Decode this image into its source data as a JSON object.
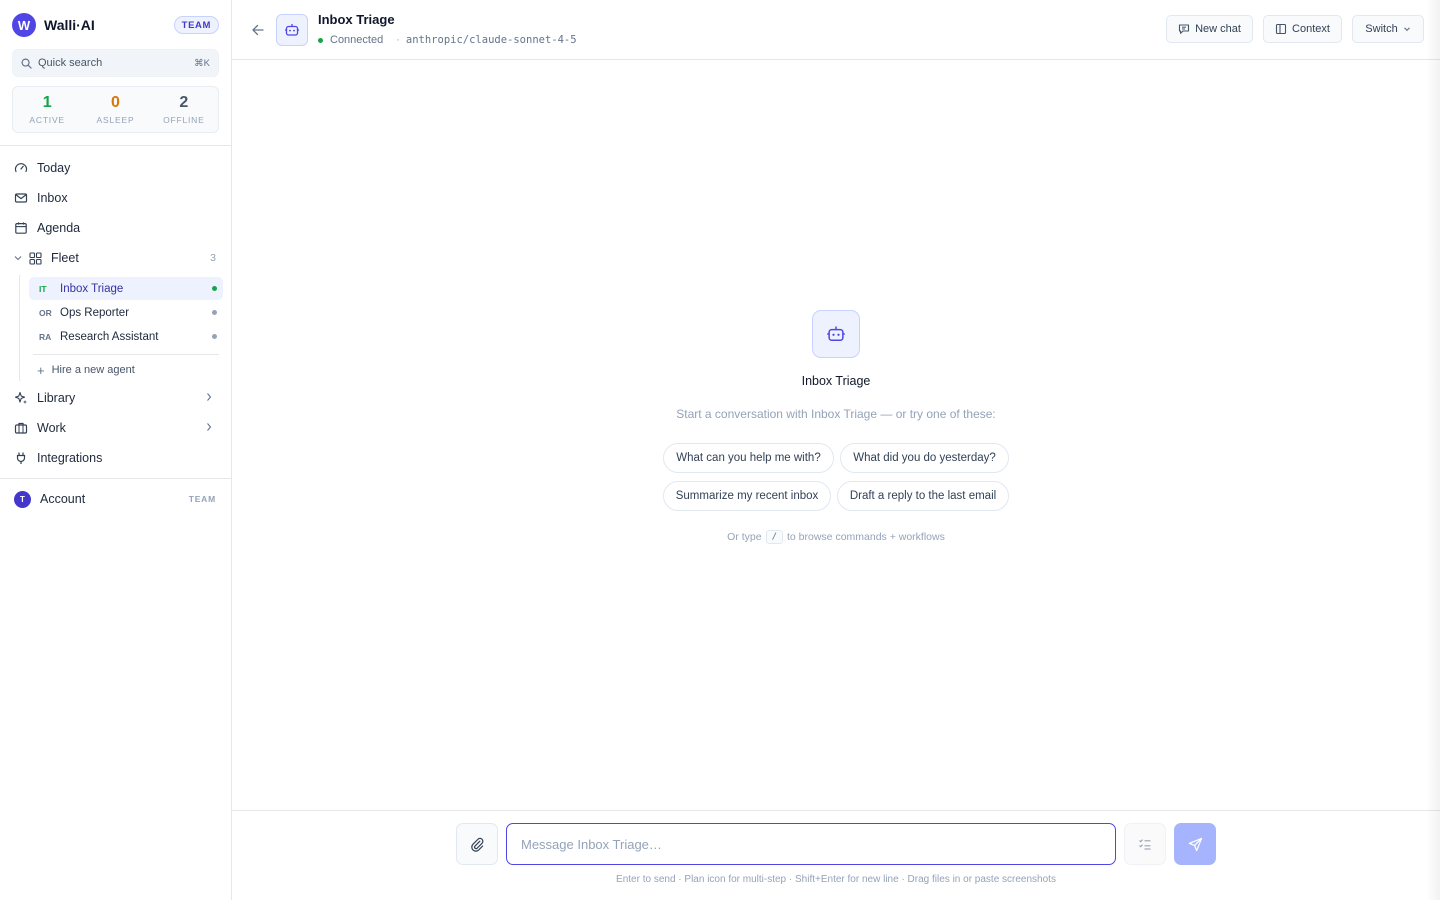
{
  "brand": {
    "logo_letter": "W",
    "name": "Walli·AI",
    "badge": "TEAM",
    "accent": "#4f46e5"
  },
  "search": {
    "label": "Quick search",
    "shortcut": "⌘K"
  },
  "stats": [
    {
      "value": "1",
      "label": "ACTIVE",
      "color": "#16a34a"
    },
    {
      "value": "0",
      "label": "ASLEEP",
      "color": "#d97706"
    },
    {
      "value": "2",
      "label": "OFFLINE",
      "color": "#475569"
    }
  ],
  "nav": {
    "today": "Today",
    "inbox": "Inbox",
    "agenda": "Agenda",
    "fleet": "Fleet",
    "fleet_count": "3",
    "library": "Library",
    "work": "Work",
    "integrations": "Integrations"
  },
  "agents": [
    {
      "tag": "IT",
      "name": "Inbox Triage",
      "status": "active"
    },
    {
      "tag": "OR",
      "name": "Ops Reporter",
      "status": "offline"
    },
    {
      "tag": "RA",
      "name": "Research Assistant",
      "status": "offline"
    }
  ],
  "hire_label": "Hire a new agent",
  "account": {
    "initial": "T",
    "label": "Account",
    "badge": "TEAM"
  },
  "header": {
    "title": "Inbox Triage",
    "status": "Connected",
    "separator": "·",
    "model": "anthropic/claude-sonnet-4-5",
    "buttons": {
      "new_chat": "New chat",
      "context": "Context",
      "switch": "Switch"
    }
  },
  "empty_state": {
    "title": "Inbox Triage",
    "subtitle": "Start a conversation with Inbox Triage — or try one of these:",
    "suggestions": [
      "What can you help me with?",
      "What did you do yesterday?",
      "Summarize my recent inbox",
      "Draft a reply to the last email"
    ],
    "hint_before": "Or type",
    "hint_key": "/",
    "hint_after": "to browse commands + workflows"
  },
  "composer": {
    "placeholder": "Message Inbox Triage…",
    "hint": "Enter to send · Plan icon for multi-step · Shift+Enter for new line · Drag files in or paste screenshots"
  }
}
